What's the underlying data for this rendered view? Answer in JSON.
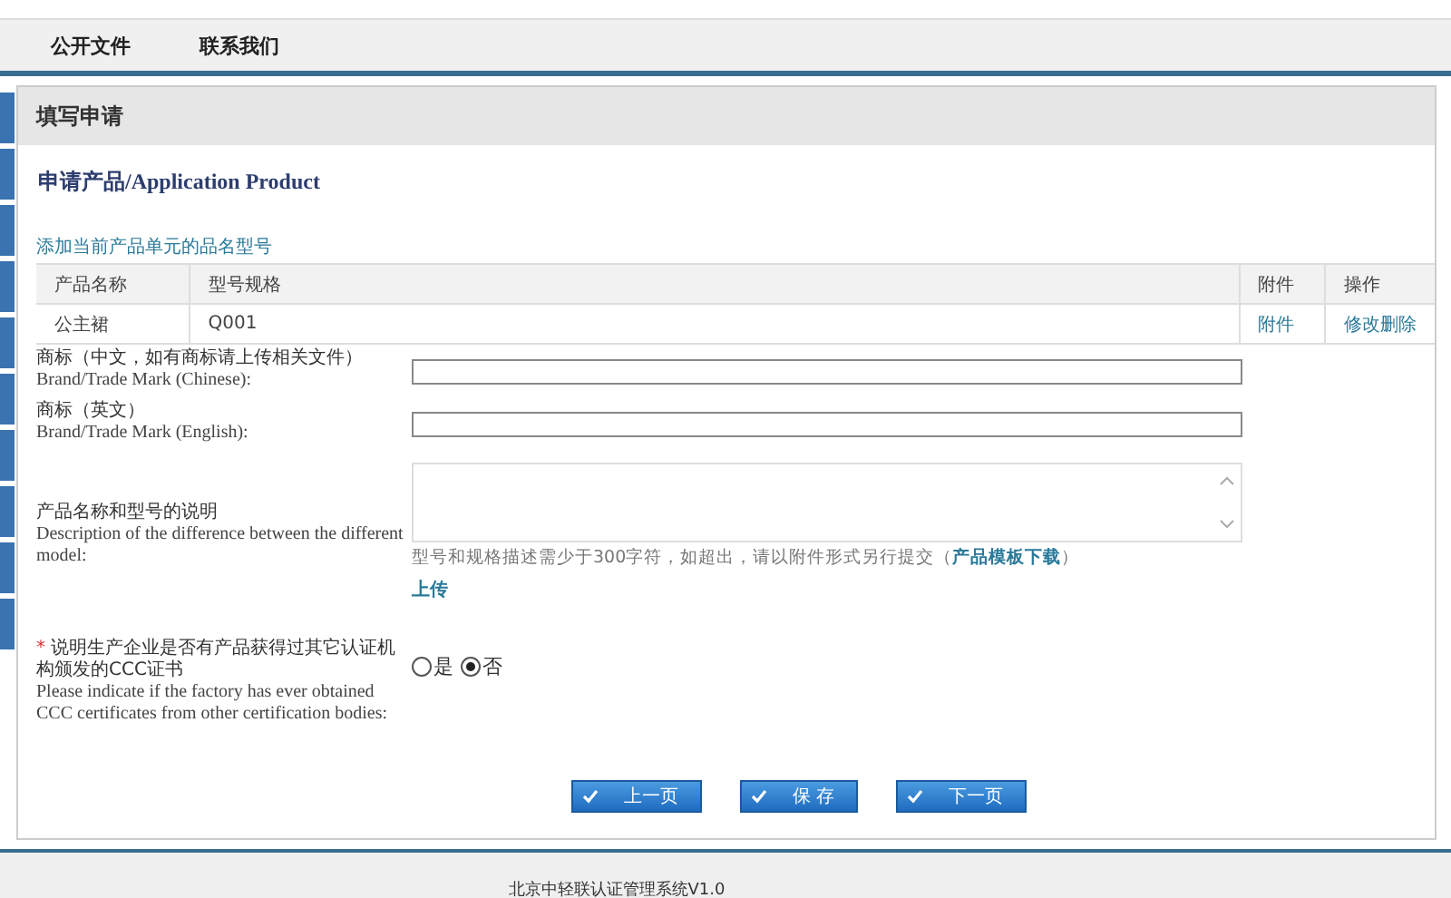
{
  "nav": {
    "items": [
      "公开文件",
      "联系我们"
    ]
  },
  "panel": {
    "title": "填写申请"
  },
  "section_title": "申请产品/Application Product",
  "add_link": "添加当前产品单元的品名型号",
  "table": {
    "columns": [
      "产品名称",
      "型号规格",
      "附件",
      "操作"
    ],
    "rows": [
      {
        "name": "公主裙",
        "model": "Q001",
        "attachment": "附件",
        "actions": [
          "修改",
          "删除"
        ]
      }
    ]
  },
  "fields": [
    {
      "kind": "input",
      "label_cn": "商标（中文，如有商标请上传相关文件）",
      "label_en": "Brand/Trade Mark (Chinese):"
    },
    {
      "kind": "input",
      "label_cn": "商标（英文）",
      "label_en": "Brand/Trade Mark (English):"
    },
    {
      "kind": "textarea",
      "label_cn": "产品名称和型号的说明",
      "label_en": "Description of the difference between the different model:",
      "hint": "型号和规格描述需少于300字符，如超出，请以附件形式另行提交（",
      "hint_link": "产品模板下载",
      "hint_end": "）",
      "upload": "上传"
    },
    {
      "kind": "radio",
      "required_mark": "*",
      "label_cn": "说明生产企业是否有产品获得过其它认证机构颁发的CCC证书",
      "label_en": "Please indicate if the factory has ever obtained CCC certificates from other certification bodies:",
      "options": [
        {
          "label": "是",
          "selected": false
        },
        {
          "label": "否",
          "selected": true
        }
      ]
    }
  ],
  "buttons": [
    "上一页",
    "保 存",
    "下一页"
  ],
  "footer": "北京中轻联认证管理系统V1.0"
}
